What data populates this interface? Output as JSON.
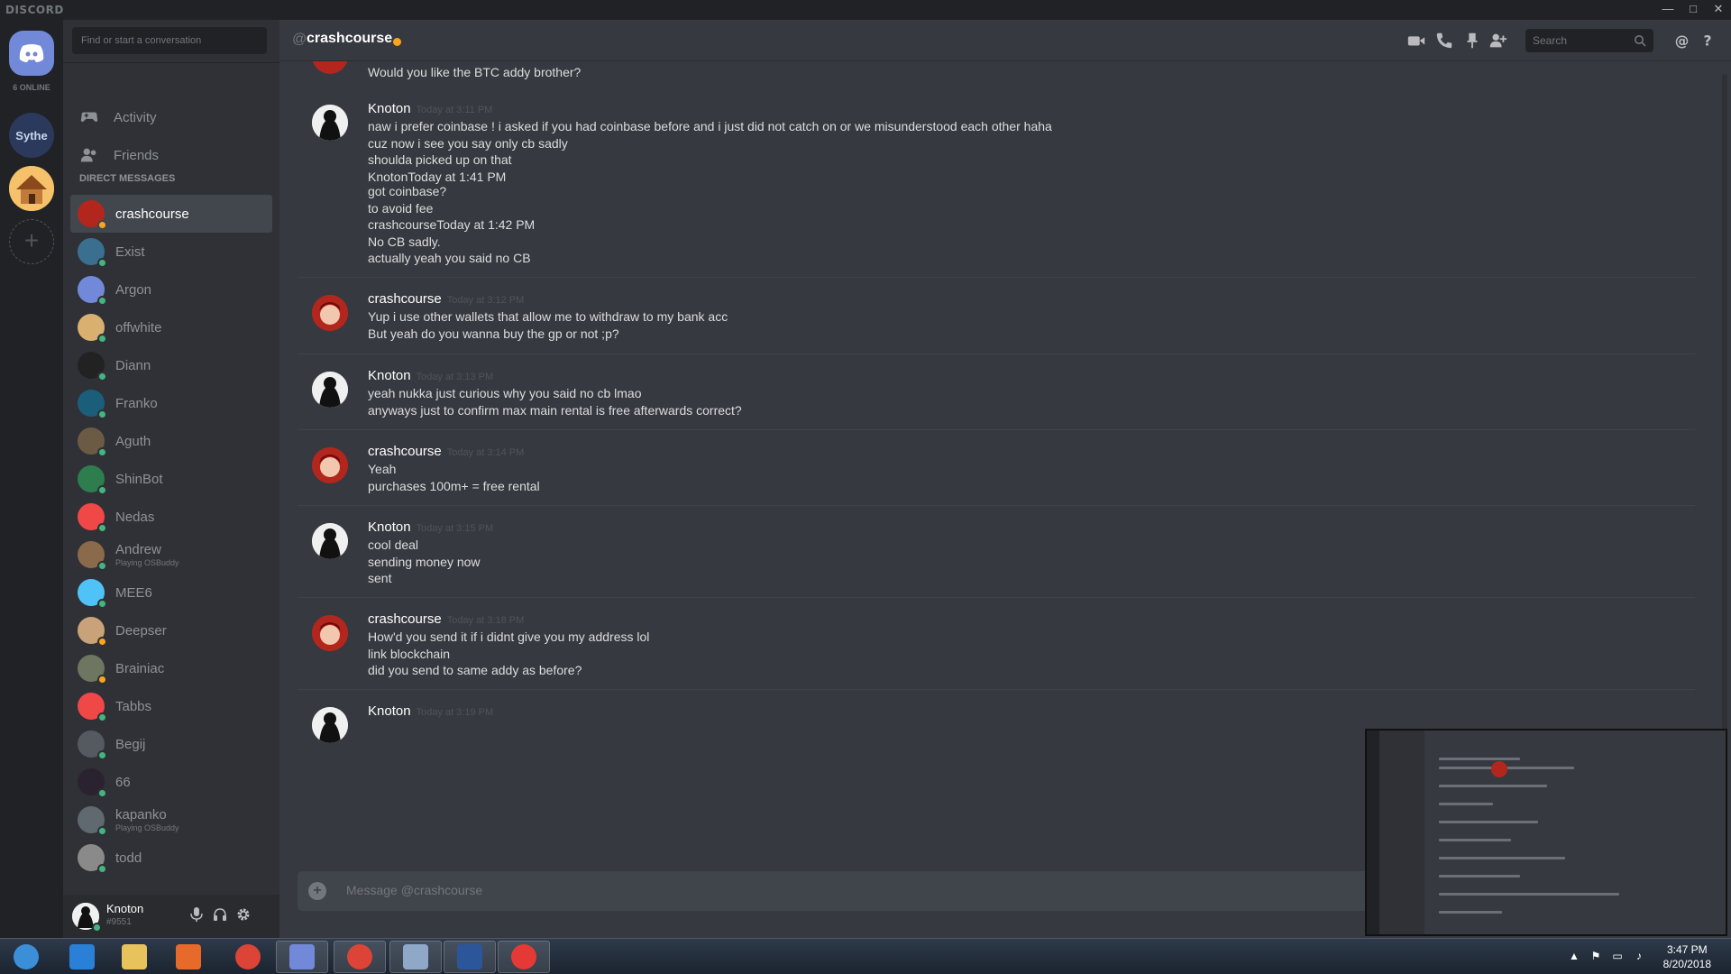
{
  "window": {
    "brand": "DISCORD",
    "controls": [
      "—",
      "□",
      "✕"
    ]
  },
  "guilds": {
    "online_count": "6 ONLINE",
    "servers": [
      {
        "label": "Sythe",
        "color": "#2b3a5c"
      },
      {
        "label": "",
        "color": "#e8a040"
      }
    ]
  },
  "sidebar": {
    "search_placeholder": "Find or start a conversation",
    "nav": [
      {
        "label": "Activity",
        "icon": "gamepad-icon"
      },
      {
        "label": "Friends",
        "icon": "friends-icon"
      }
    ],
    "dm_header": "DIRECT MESSAGES",
    "dms": [
      {
        "name": "crashcourse",
        "sub": "",
        "color": "#b3261e",
        "status": "#faa61a",
        "active": true
      },
      {
        "name": "Exist",
        "sub": "",
        "color": "#3a6f8f",
        "status": "#43b581"
      },
      {
        "name": "Argon",
        "sub": "",
        "color": "#7289da",
        "status": "#43b581"
      },
      {
        "name": "offwhite",
        "sub": "",
        "color": "#d9b070",
        "status": "#43b581"
      },
      {
        "name": "Diann",
        "sub": "",
        "color": "#222222",
        "status": "#43b581"
      },
      {
        "name": "Franko",
        "sub": "",
        "color": "#1b5e7a",
        "status": "#43b581"
      },
      {
        "name": "Aguth",
        "sub": "",
        "color": "#6b5b45",
        "status": "#43b581"
      },
      {
        "name": "ShinBot",
        "sub": "",
        "color": "#2e7d4f",
        "status": "#43b581"
      },
      {
        "name": "Nedas",
        "sub": "",
        "color": "#f04747",
        "status": "#43b581"
      },
      {
        "name": "Andrew",
        "sub": "Playing OSBuddy",
        "color": "#8a6a4a",
        "status": "#43b581"
      },
      {
        "name": "MEE6",
        "sub": "",
        "color": "#4fc3f7",
        "status": "#43b581"
      },
      {
        "name": "Deepser",
        "sub": "",
        "color": "#c9a27a",
        "status": "#faa61a"
      },
      {
        "name": "Brainiac",
        "sub": "",
        "color": "#6e7560",
        "status": "#faa61a"
      },
      {
        "name": "Tabbs",
        "sub": "",
        "color": "#f04747",
        "status": "#43b581"
      },
      {
        "name": "Begij",
        "sub": "",
        "color": "#555a60",
        "status": "#43b581"
      },
      {
        "name": "66",
        "sub": "",
        "color": "#2a2230",
        "status": "#43b581"
      },
      {
        "name": "kapanko",
        "sub": "Playing OSBuddy",
        "color": "#606870",
        "status": "#43b581"
      },
      {
        "name": "todd",
        "sub": "",
        "color": "#8a8a8a",
        "status": "#43b581"
      }
    ]
  },
  "user": {
    "name": "Knoton",
    "tag": "#9551"
  },
  "chat": {
    "at": "@",
    "channel": "crashcourse",
    "search_placeholder": "Search",
    "composer_placeholder": "Message @crashcourse",
    "partial_top": "Would you like the BTC addy brother?",
    "groups": [
      {
        "author": "Knoton",
        "time": "Today at 3:11 PM",
        "avatar_color": "#e8e8e8",
        "lines": [
          "naw i prefer coinbase ! i asked if you had coinbase before and i just did not catch on or we misunderstood each other haha",
          "cuz now i see you say only cb sadly",
          "shoulda picked up on that",
          "KnotonToday at 1:41 PM",
          "got coinbase?",
          "to avoid fee",
          "crashcourseToday at 1:42 PM",
          "No CB sadly.",
          "actually yeah you said no CB"
        ]
      },
      {
        "author": "crashcourse",
        "time": "Today at 3:12 PM",
        "avatar_color": "#b3261e",
        "lines": [
          "Yup i use other wallets that allow me to withdraw to my bank acc",
          "But yeah do you wanna buy the gp or not ;p?"
        ]
      },
      {
        "author": "Knoton",
        "time": "Today at 3:13 PM",
        "avatar_color": "#e8e8e8",
        "lines": [
          "yeah nukka just curious why you said no cb lmao",
          "anyways just to confirm max main rental is free afterwards correct?"
        ]
      },
      {
        "author": "crashcourse",
        "time": "Today at 3:14 PM",
        "avatar_color": "#b3261e",
        "lines": [
          "Yeah",
          "purchases 100m+ = free rental"
        ]
      },
      {
        "author": "Knoton",
        "time": "Today at 3:15 PM",
        "avatar_color": "#e8e8e8",
        "lines": [
          "cool deal",
          "sending money now",
          "sent"
        ]
      },
      {
        "author": "crashcourse",
        "time": "Today at 3:18 PM",
        "avatar_color": "#b3261e",
        "lines": [
          "How'd you send it if i didnt give you my address lol",
          "link blockchain",
          "did you send to same addy as before?"
        ]
      },
      {
        "author": "Knoton",
        "time": "Today at 3:19 PM",
        "avatar_color": "#e8e8e8",
        "lines": []
      }
    ]
  },
  "taskbar": {
    "time": "3:47 PM",
    "date": "8/20/2018",
    "apps": [
      {
        "name": "start-button",
        "color": "#3b8fd8"
      },
      {
        "name": "internet-explorer",
        "color": "#2a7fd6"
      },
      {
        "name": "file-explorer",
        "color": "#e8c25a"
      },
      {
        "name": "media-player",
        "color": "#e86a2a"
      },
      {
        "name": "chrome",
        "color": "#db4437"
      },
      {
        "name": "discord",
        "color": "#7289da"
      },
      {
        "name": "chrome-2",
        "color": "#db4437"
      },
      {
        "name": "calculator",
        "color": "#8fa8c8"
      },
      {
        "name": "word",
        "color": "#2b579a"
      },
      {
        "name": "recorder",
        "color": "#e53935"
      }
    ]
  }
}
